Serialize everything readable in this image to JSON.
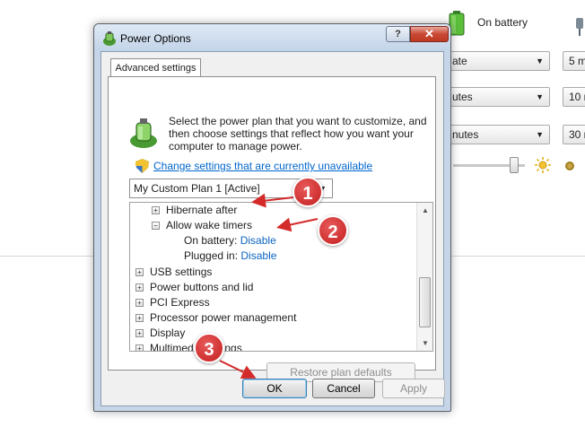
{
  "background": {
    "status_label": "On battery",
    "selects": [
      {
        "text": "ate",
        "right_text": "5 m"
      },
      {
        "text": "utes",
        "right_text": "10 m"
      },
      {
        "text": "nutes",
        "right_text": "30 m"
      }
    ]
  },
  "dialog": {
    "title": "Power Options",
    "help_label": "?",
    "close_label": "✕",
    "tab_label": "Advanced settings",
    "description": "Select the power plan that you want to customize, and then choose settings that reflect how you want your computer to manage power.",
    "change_link": "Change settings that are currently unavailable",
    "plan_select_value": "My Custom Plan 1 [Active]",
    "tree": {
      "hibernate": "Hibernate after",
      "wake_timers": "Allow wake timers",
      "on_battery_label": "On battery:",
      "on_battery_value": "Disable",
      "plugged_in_label": "Plugged in:",
      "plugged_in_value": "Disable",
      "usb": "USB settings",
      "power_buttons": "Power buttons and lid",
      "pci": "PCI Express",
      "processor": "Processor power management",
      "display": "Display",
      "multimedia": "Multimedia settings"
    },
    "restore_label": "Restore plan defaults",
    "ok_label": "OK",
    "cancel_label": "Cancel",
    "apply_label": "Apply"
  },
  "annotations": {
    "markers": [
      "1",
      "2",
      "3"
    ],
    "color": "#d42a2a"
  }
}
